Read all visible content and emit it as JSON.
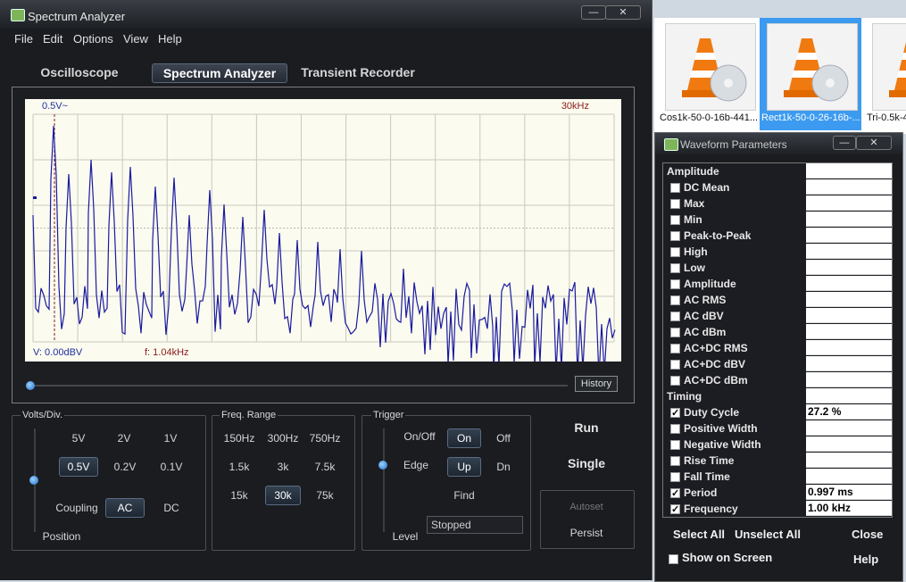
{
  "main_window": {
    "title": "Spectrum Analyzer",
    "window_controls": [
      "—",
      "✕"
    ],
    "menu": [
      "File",
      "Edit",
      "Options",
      "View",
      "Help"
    ],
    "modes": [
      "Oscilloscope",
      "Spectrum Analyzer",
      "Transient Recorder"
    ],
    "active_mode": "Spectrum Analyzer",
    "display": {
      "top_left_label": "0.5V~",
      "top_right_label": "30kHz",
      "cursor_v_readout": "V: 0.00dBV",
      "cursor_f_readout": "f: 1.04kHz",
      "history_button": "History",
      "trace_color": "#1a1aa0",
      "cursor_color": "#8b1a1a",
      "background_color": "#fbfbef"
    },
    "volts_div": {
      "label": "Volts/Div.",
      "options": [
        "5V",
        "2V",
        "1V",
        "0.5V",
        "0.2V",
        "0.1V"
      ],
      "selected": "0.5V",
      "coupling_label": "Coupling",
      "coupling_options": [
        "AC",
        "DC"
      ],
      "coupling_selected": "AC",
      "position_label": "Position"
    },
    "freq_range": {
      "label": "Freq. Range",
      "options": [
        "150Hz",
        "300Hz",
        "750Hz",
        "1.5k",
        "3k",
        "7.5k",
        "15k",
        "30k",
        "75k"
      ],
      "selected": "30k"
    },
    "trigger": {
      "label": "Trigger",
      "onoff_label": "On/Off",
      "onoff_options": [
        "On",
        "Off"
      ],
      "onoff_selected": "On",
      "edge_label": "Edge",
      "edge_options": [
        "Up",
        "Dn"
      ],
      "edge_selected": "Up",
      "find_label": "Find",
      "level_label": "Level",
      "status": "Stopped"
    },
    "actions": {
      "run": "Run",
      "single": "Single",
      "autoset": "Autoset",
      "persist": "Persist"
    }
  },
  "thumbnails": [
    {
      "label": "Cos1k-50-0-16b-441...",
      "selected": false
    },
    {
      "label": "Rect1k-50-0-26-16b-...",
      "selected": true
    },
    {
      "label": "Tri-0.5k-4",
      "selected": false
    }
  ],
  "params_window": {
    "title": "Waveform Parameters",
    "window_controls": [
      "—",
      "✕"
    ],
    "sections": [
      {
        "name": "Amplitude",
        "rows": [
          {
            "label": "DC  Mean",
            "checked": false,
            "value": ""
          },
          {
            "label": "Max",
            "checked": false,
            "value": ""
          },
          {
            "label": "Min",
            "checked": false,
            "value": ""
          },
          {
            "label": "Peak-to-Peak",
            "checked": false,
            "value": ""
          },
          {
            "label": "High",
            "checked": false,
            "value": ""
          },
          {
            "label": "Low",
            "checked": false,
            "value": ""
          },
          {
            "label": "Amplitude",
            "checked": false,
            "value": ""
          },
          {
            "label": "AC RMS",
            "checked": false,
            "value": ""
          },
          {
            "label": "AC dBV",
            "checked": false,
            "value": ""
          },
          {
            "label": "AC dBm",
            "checked": false,
            "value": ""
          },
          {
            "label": "AC+DC RMS",
            "checked": false,
            "value": ""
          },
          {
            "label": "AC+DC dBV",
            "checked": false,
            "value": ""
          },
          {
            "label": "AC+DC dBm",
            "checked": false,
            "value": ""
          }
        ]
      },
      {
        "name": "Timing",
        "rows": [
          {
            "label": "Duty Cycle",
            "checked": true,
            "value": "27.2 %"
          },
          {
            "label": "Positive Width",
            "checked": false,
            "value": ""
          },
          {
            "label": "Negative Width",
            "checked": false,
            "value": ""
          },
          {
            "label": "Rise Time",
            "checked": false,
            "value": ""
          },
          {
            "label": "Fall Time",
            "checked": false,
            "value": ""
          },
          {
            "label": "Period",
            "checked": true,
            "value": "0.997 ms"
          },
          {
            "label": "Frequency",
            "checked": true,
            "value": "1.00 kHz"
          }
        ]
      }
    ],
    "select_all": "Select All",
    "unselect_all": "Unselect All",
    "close": "Close",
    "show_on_screen": "Show on Screen",
    "help": "Help"
  }
}
